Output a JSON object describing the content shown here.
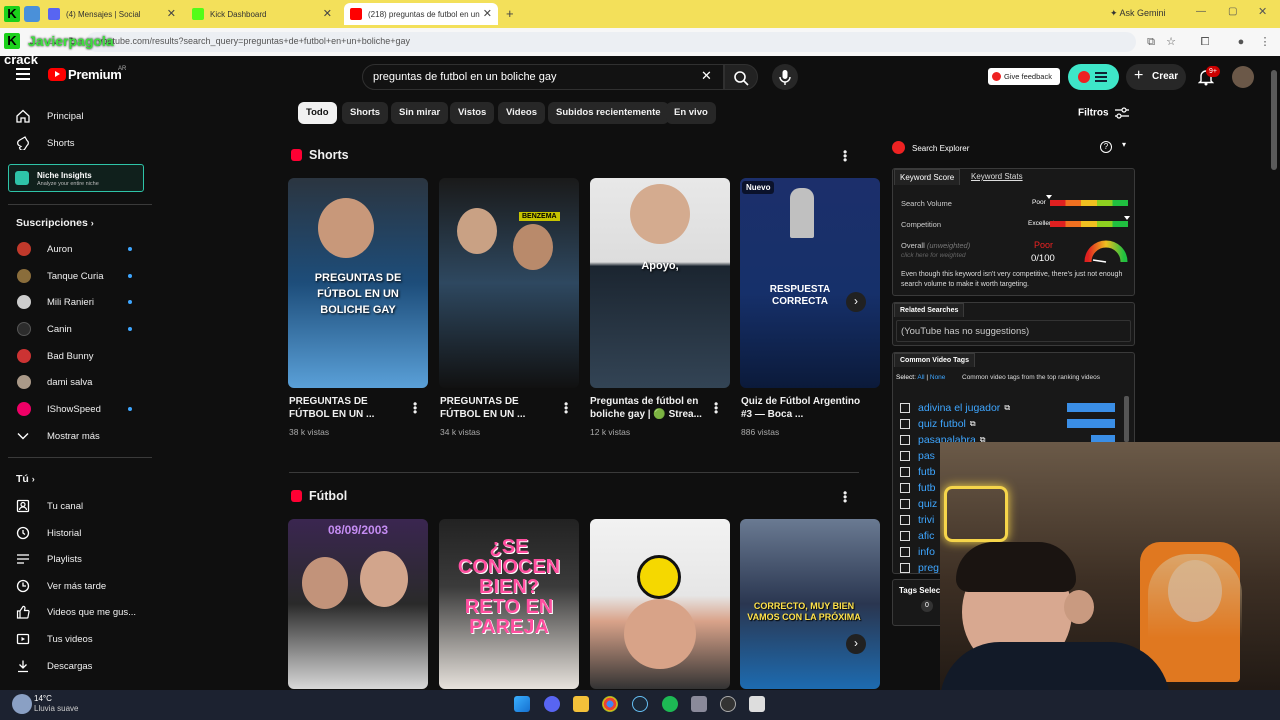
{
  "browser": {
    "tabs": [
      {
        "title": "(4) Mensajes | Social",
        "active": false
      },
      {
        "title": "Kick Dashboard",
        "active": false
      },
      {
        "title": "(218) preguntas de futbol en un",
        "active": true
      }
    ],
    "new_tab": "+",
    "ask_gemini": "Ask Gemini",
    "url": "youtube.com/results?search_query=preguntas+de+futbol+en+un+boliche+gay"
  },
  "overlay": {
    "streamer": "Javierpagola",
    "label": "crack"
  },
  "header": {
    "logo": "Premium",
    "country": "AR",
    "search_value": "preguntas de futbol en un boliche gay",
    "clear": "✕",
    "give_feedback": "Give feedback",
    "create": "Crear",
    "notif_count": "9+"
  },
  "sidebar": {
    "main": [
      {
        "label": "Principal",
        "icon": "home-icon"
      },
      {
        "label": "Shorts",
        "icon": "shorts-icon"
      }
    ],
    "niche": {
      "title": "Niche Insights",
      "subtitle": "Analyze your entire niche"
    },
    "subs_header": "Suscripciones",
    "subs": [
      {
        "label": "Auron",
        "color": "#c0392b"
      },
      {
        "label": "Tanque Curia",
        "color": "#8a6d3b"
      },
      {
        "label": "Mili Ranieri",
        "color": "#ddd"
      },
      {
        "label": "Canin",
        "color": "#3b5"
      },
      {
        "label": "Bad Bunny",
        "color": "#c33"
      },
      {
        "label": "dami salva",
        "color": "#aa8"
      },
      {
        "label": "IShowSpeed",
        "color": "#e06"
      }
    ],
    "show_more": "Mostrar más",
    "you_header": "Tú",
    "you": [
      {
        "label": "Tu canal",
        "icon": "channel-icon"
      },
      {
        "label": "Historial",
        "icon": "history-icon"
      },
      {
        "label": "Playlists",
        "icon": "playlist-icon"
      },
      {
        "label": "Ver más tarde",
        "icon": "clock-icon"
      },
      {
        "label": "Videos que me gus...",
        "icon": "like-icon"
      },
      {
        "label": "Tus videos",
        "icon": "video-icon"
      },
      {
        "label": "Descargas",
        "icon": "download-icon"
      }
    ]
  },
  "chips": [
    "Todo",
    "Shorts",
    "Sin mirar",
    "Vistos",
    "Videos",
    "Subidos recientemente",
    "En vivo"
  ],
  "filters": "Filtros",
  "sections": {
    "shorts_title": "Shorts",
    "futbol_title": "Fútbol"
  },
  "shorts": [
    {
      "title": "PREGUNTAS DE FÚTBOL EN UN ...",
      "views": "38 k vistas",
      "overlay": "PREGUNTAS DE FÚTBOL EN UN BOLICHE GAY"
    },
    {
      "title": "PREGUNTAS DE FÚTBOL EN UN ...",
      "views": "34 k vistas",
      "overlay": "BENZEMA"
    },
    {
      "title": "Preguntas de fútbol en boliche gay | 🟢 Strea...",
      "views": "12 k vistas",
      "overlay": "Apoyo,"
    },
    {
      "title": "Quiz de Fútbol Argentino #3 — Boca ...",
      "views": "886 vistas",
      "overlay": "RESPUESTA CORRECTA",
      "badge": "Nuevo"
    }
  ],
  "futbol_thumbs": [
    {
      "overlay": "08/09/2003"
    },
    {
      "overlay": "¿SE CONOCEN BIEN? RETO EN PAREJA"
    },
    {
      "overlay": ""
    },
    {
      "overlay": "CORRECTO, MUY BIEN VAMOS CON LA PRÓXIMA"
    }
  ],
  "extension": {
    "title": "Search Explorer",
    "tab_score": "Keyword Score",
    "tab_stats": "Keyword Stats",
    "search_volume": "Search Volume",
    "sv_rating": "Poor",
    "competition": "Competition",
    "comp_rating": "Excellent",
    "overall": "Overall",
    "unweighted": "(unweighted)",
    "click_weighted": "click here for weighted",
    "overall_rating": "Poor",
    "score": "0/100",
    "note": "Even though this keyword isn't very competitive, there's just not enough search volume to make it worth targeting.",
    "related_title": "Related Searches",
    "related_text": "(YouTube has no suggestions)",
    "tags_title": "Common Video Tags",
    "select": "Select:",
    "all": "All",
    "none": "None",
    "tags_note": "Common video tags from the top ranking videos",
    "tags": [
      "adivina el jugador",
      "quiz futbol",
      "pasapalabra",
      "pas",
      "futb",
      "futb",
      "quiz",
      "trivi",
      "afic",
      "info",
      "preg"
    ],
    "tags_selected": "Tags Selec",
    "tags_count": "0"
  },
  "taskbar": {
    "temp": "14°C",
    "weather": "Lluvia suave"
  },
  "colors": {
    "yt_red": "#ff0000",
    "accent_blue": "#3ea6ff",
    "kick_green": "#53fc18",
    "tabbar": "#f3e05a"
  }
}
